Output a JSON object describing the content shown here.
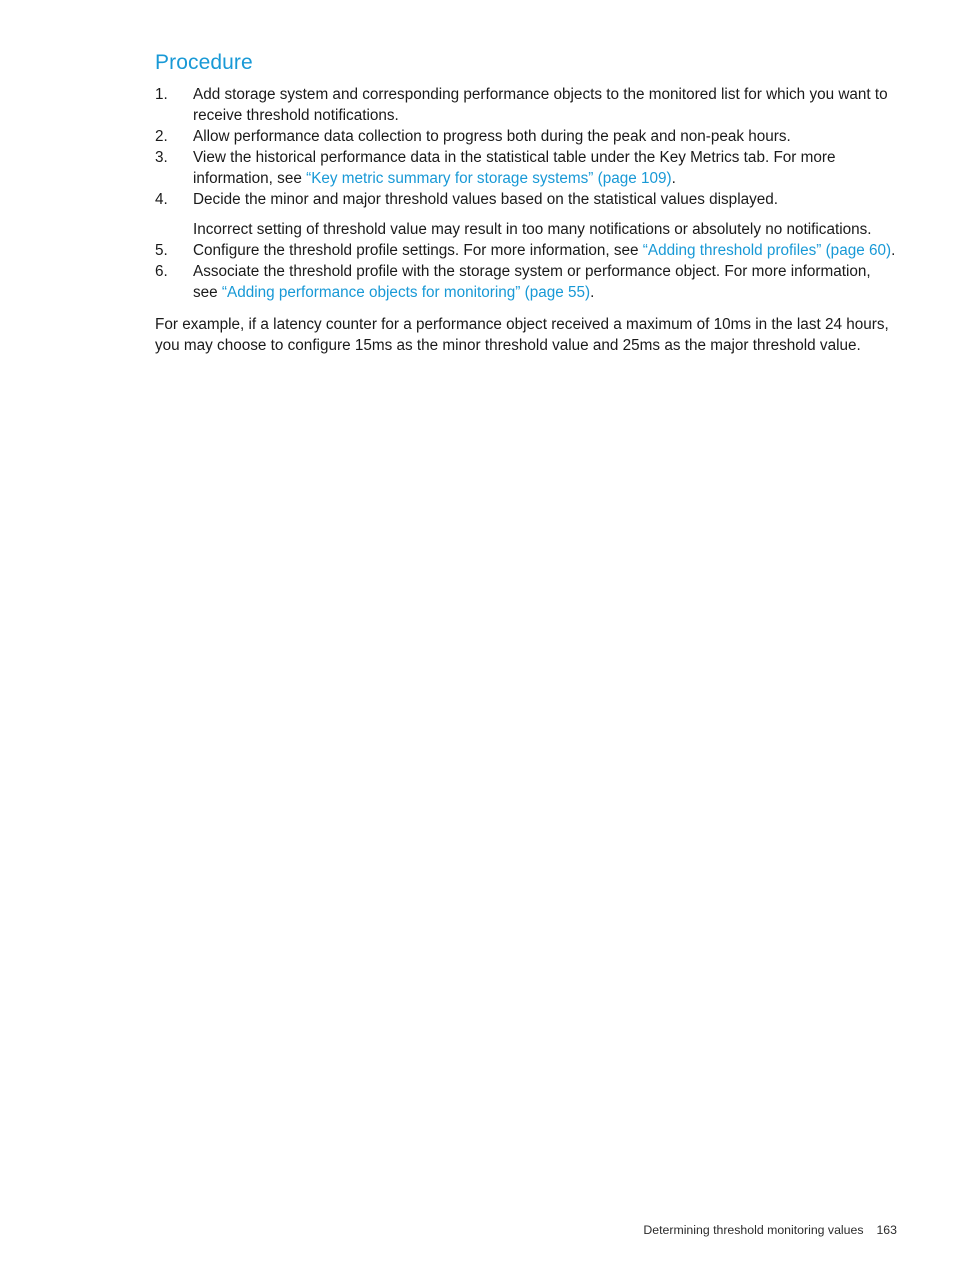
{
  "page": {
    "background_color": "#ffffff",
    "accent_color": "#1899d6",
    "text_color": "#1a1a1a"
  },
  "section": {
    "title": "Procedure"
  },
  "procedure": {
    "items": [
      {
        "number": "1.",
        "text": "Add storage system and corresponding performance objects to the monitored list for which you want to receive threshold notifications."
      },
      {
        "number": "2.",
        "text": "Allow performance data collection to progress both during the peak and non-peak hours."
      },
      {
        "number": "3.",
        "text_before": "View the historical performance data in the statistical table under the Key Metrics tab. For more information, see ",
        "link": "“Key metric summary for storage systems” (page 109)",
        "text_after": "."
      },
      {
        "number": "4.",
        "text": "Decide the minor and major threshold values based on the statistical values displayed.",
        "sub_paragraph": "Incorrect setting of threshold value may result in too many notifications or absolutely no notifications."
      },
      {
        "number": "5.",
        "text_before": "Configure the threshold profile settings. For more information, see ",
        "link": "“Adding threshold profiles” (page 60)",
        "text_after": "."
      },
      {
        "number": "6.",
        "text_before": "Associate the threshold profile with the storage system or performance object. For more information, see ",
        "link": "“Adding performance objects for monitoring” (page 55)",
        "text_after": "."
      }
    ]
  },
  "example": {
    "text": "For example, if a latency counter for a performance object received a maximum of 10ms in the last 24 hours, you may choose to configure 15ms as the minor threshold value and 25ms as the major threshold value."
  },
  "footer": {
    "chapter_title": "Determining threshold monitoring values",
    "page_number": "163"
  }
}
